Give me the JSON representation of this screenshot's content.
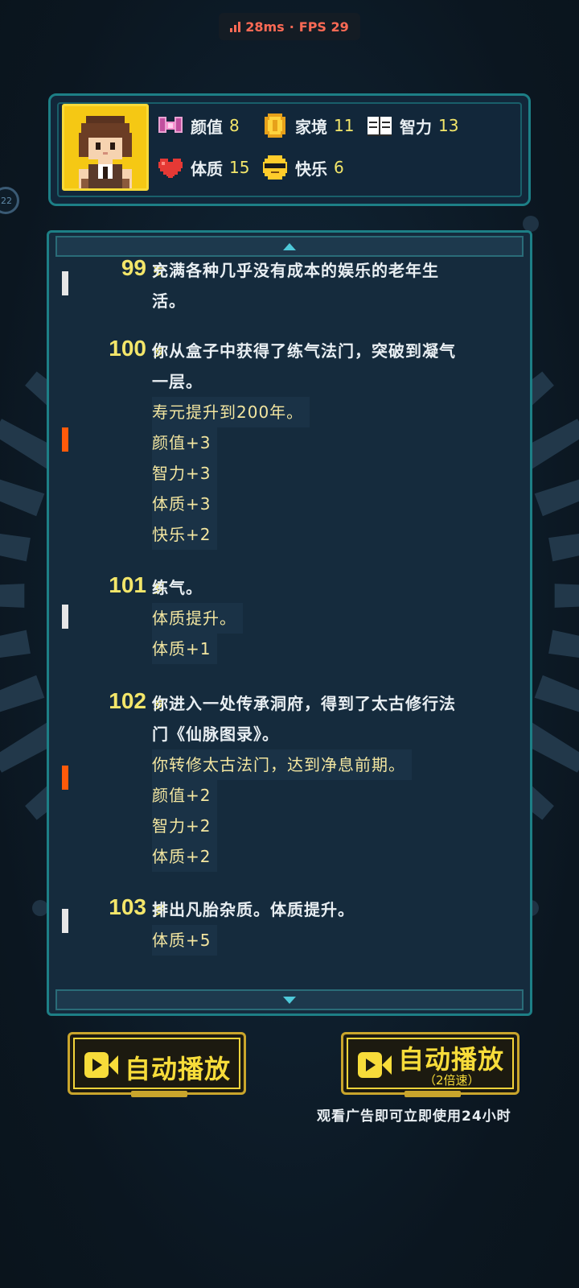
{
  "status": {
    "ping": "28ms",
    "separator": "·",
    "fps": "FPS 29"
  },
  "side_badge": "22",
  "stats": [
    {
      "icon": "bow-icon",
      "label": "颜值",
      "value": "8"
    },
    {
      "icon": "coin-icon",
      "label": "家境",
      "value": "11"
    },
    {
      "icon": "book-icon",
      "label": "智力",
      "value": "13"
    },
    {
      "icon": "heart-icon",
      "label": "体质",
      "value": "15"
    },
    {
      "icon": "sunglasses-face-icon",
      "label": "快乐",
      "value": "6"
    }
  ],
  "log": [
    {
      "age": "99",
      "unit": "岁",
      "marker": "white",
      "lines": [
        {
          "text": "充满各种几乎没有成本的娱乐的老年生",
          "style": "white"
        },
        {
          "text": "活。",
          "style": "white"
        }
      ]
    },
    {
      "age": "100",
      "unit": "岁",
      "marker": "orange",
      "lines": [
        {
          "text": "你从盒子中获得了练气法门，突破到凝气",
          "style": "white"
        },
        {
          "text": "一层。",
          "style": "white"
        },
        {
          "text": "寿元提升到200年。",
          "style": "yellow"
        },
        {
          "text": "颜值+3",
          "style": "yellow"
        },
        {
          "text": "智力+3",
          "style": "yellow"
        },
        {
          "text": "体质+3",
          "style": "yellow"
        },
        {
          "text": "快乐+2",
          "style": "yellow"
        }
      ]
    },
    {
      "age": "101",
      "unit": "岁",
      "marker": "white",
      "lines": [
        {
          "text": "练气。",
          "style": "white"
        },
        {
          "text": "体质提升。",
          "style": "yellow"
        },
        {
          "text": "体质+1",
          "style": "yellow"
        }
      ]
    },
    {
      "age": "102",
      "unit": "岁",
      "marker": "orange",
      "lines": [
        {
          "text": "你进入一处传承洞府，得到了太古修行法",
          "style": "white"
        },
        {
          "text": "门《仙脉图录》。",
          "style": "white"
        },
        {
          "text": "你转修太古法门，达到净息前期。",
          "style": "yellow"
        },
        {
          "text": "颜值+2",
          "style": "yellow"
        },
        {
          "text": "智力+2",
          "style": "yellow"
        },
        {
          "text": "体质+2",
          "style": "yellow"
        }
      ]
    },
    {
      "age": "103",
      "unit": "岁",
      "marker": "white",
      "lines": [
        {
          "text": "排出凡胎杂质。体质提升。",
          "style": "white"
        },
        {
          "text": "体质+5",
          "style": "yellow"
        }
      ]
    }
  ],
  "buttons": {
    "auto_play": "自动播放",
    "auto_play_2x": "自动播放",
    "auto_play_2x_sub": "（2倍速）"
  },
  "ad_note": "观看广告即可立即使用24小时",
  "colors": {
    "accent_yellow": "#f3e66a",
    "frame_teal": "#1d7f86",
    "marker_orange": "#ff5a0a"
  }
}
